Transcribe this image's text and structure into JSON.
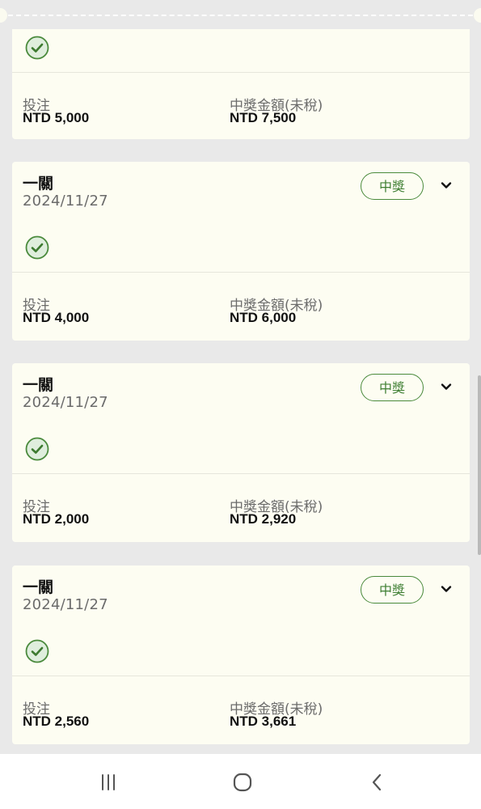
{
  "cards": [
    {
      "title": "",
      "date": "",
      "badge": "",
      "stake_label": "投注",
      "stake": "NTD 5,000",
      "prize_label": "中獎金額(未稅)",
      "prize": "NTD 7,500"
    },
    {
      "title": "一關",
      "date": "2024/11/27",
      "badge": "中獎",
      "stake_label": "投注",
      "stake": "NTD 4,000",
      "prize_label": "中獎金額(未稅)",
      "prize": "NTD 6,000"
    },
    {
      "title": "一關",
      "date": "2024/11/27",
      "badge": "中獎",
      "stake_label": "投注",
      "stake": "NTD 2,000",
      "prize_label": "中獎金額(未稅)",
      "prize": "NTD 2,920"
    },
    {
      "title": "一關",
      "date": "2024/11/27",
      "badge": "中獎",
      "stake_label": "投注",
      "stake": "NTD 2,560",
      "prize_label": "中獎金額(未稅)",
      "prize": "NTD 3,661"
    }
  ],
  "icons": {
    "check": "check-circle-icon",
    "expand": "chevron-down-icon",
    "nav_recents": "recent-apps-icon",
    "nav_home": "home-icon",
    "nav_back": "back-icon"
  },
  "colors": {
    "card_background": "#fdfdf2",
    "page_background": "#e9e9e9",
    "win_green": "#4a8a3c",
    "check_fill": "#dfeedd"
  }
}
